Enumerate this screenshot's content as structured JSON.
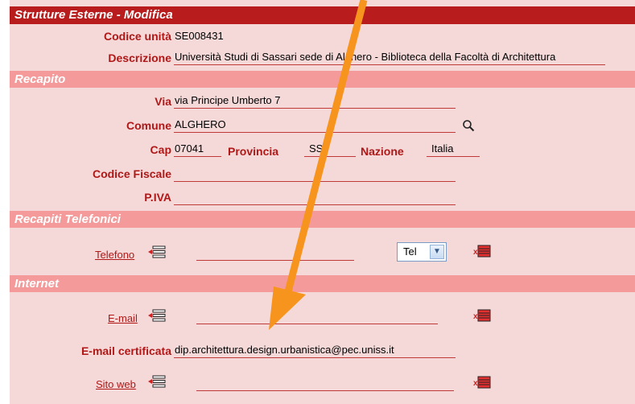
{
  "header": {
    "title": "Strutture Esterne - Modifica"
  },
  "unit": {
    "codice_label": "Codice unità",
    "codice_value": "SE008431",
    "descrizione_label": "Descrizione",
    "descrizione_value": "Università Studi di Sassari sede di Alghero - Biblioteca della Facoltà di Architettura"
  },
  "recapito": {
    "title": "Recapito",
    "via_label": "Via",
    "via_value": "via Principe Umberto 7",
    "comune_label": "Comune",
    "comune_value": "ALGHERO",
    "cap_label": "Cap",
    "cap_value": "07041",
    "provincia_label": "Provincia",
    "provincia_value": "SS",
    "nazione_label": "Nazione",
    "nazione_value": "Italia",
    "cf_label": "Codice Fiscale",
    "cf_value": "",
    "piva_label": "P.IVA",
    "piva_value": ""
  },
  "telefonici": {
    "title": "Recapiti Telefonici",
    "telefono_label": "Telefono",
    "telefono_value": "",
    "tipo_selected": "Tel"
  },
  "internet": {
    "title": "Internet",
    "email_label": "E-mail",
    "email_value": "",
    "pec_label": "E-mail certificata",
    "pec_value": "dip.architettura.design.urbanistica@pec.uniss.it",
    "sito_label": "Sito web",
    "sito_value": ""
  },
  "icons": {
    "lookup": "magnifier-icon",
    "list": "list-add-icon",
    "delete": "delete-row-icon",
    "annotation": "orange-arrow-annotation"
  },
  "colors": {
    "header_bg": "#b81c1c",
    "section_bg": "#f49a9a",
    "panel_bg": "#f5d9d9",
    "label": "#b01818",
    "arrow": "#f7941d"
  }
}
